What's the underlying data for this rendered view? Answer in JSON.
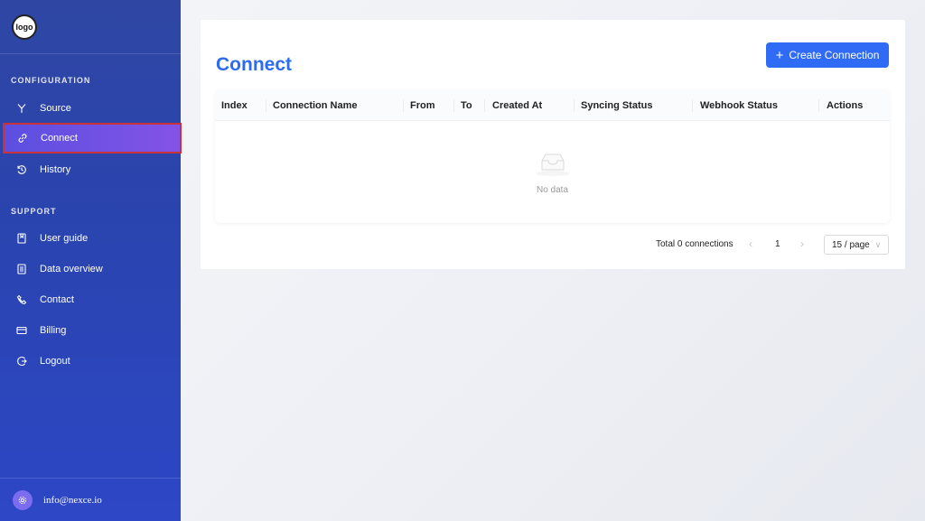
{
  "sidebar": {
    "logo_text": "logo",
    "sections": [
      {
        "title": "CONFIGURATION",
        "items": [
          {
            "label": "Source",
            "icon": "merge-icon"
          },
          {
            "label": "Connect",
            "icon": "link-icon",
            "active": true
          },
          {
            "label": "History",
            "icon": "history-icon"
          }
        ]
      },
      {
        "title": "SUPPORT",
        "items": [
          {
            "label": "User guide",
            "icon": "book-icon"
          },
          {
            "label": "Data overview",
            "icon": "document-icon"
          },
          {
            "label": "Contact",
            "icon": "phone-icon"
          },
          {
            "label": "Billing",
            "icon": "credit-card-icon"
          },
          {
            "label": "Logout",
            "icon": "logout-icon"
          }
        ]
      }
    ],
    "footer": {
      "email": "info@nexce.io",
      "icon": "settings-icon"
    }
  },
  "main": {
    "title": "Connect",
    "create_button": "Create Connection",
    "table": {
      "columns": [
        "Index",
        "Connection Name",
        "From",
        "To",
        "Created At",
        "Syncing Status",
        "Webhook Status",
        "Actions"
      ],
      "rows": [],
      "empty_text": "No data"
    },
    "pagination": {
      "total_text": "Total 0 connections",
      "current_page": "1",
      "page_size": "15 / page"
    }
  },
  "colors": {
    "sidebar_gradient_top": "#2f46a3",
    "sidebar_gradient_bottom": "#2d47c6",
    "active_item": "#6a4fe4",
    "active_outline": "#c8323b",
    "primary": "#2f6bf5",
    "title": "#2d6cf0"
  }
}
